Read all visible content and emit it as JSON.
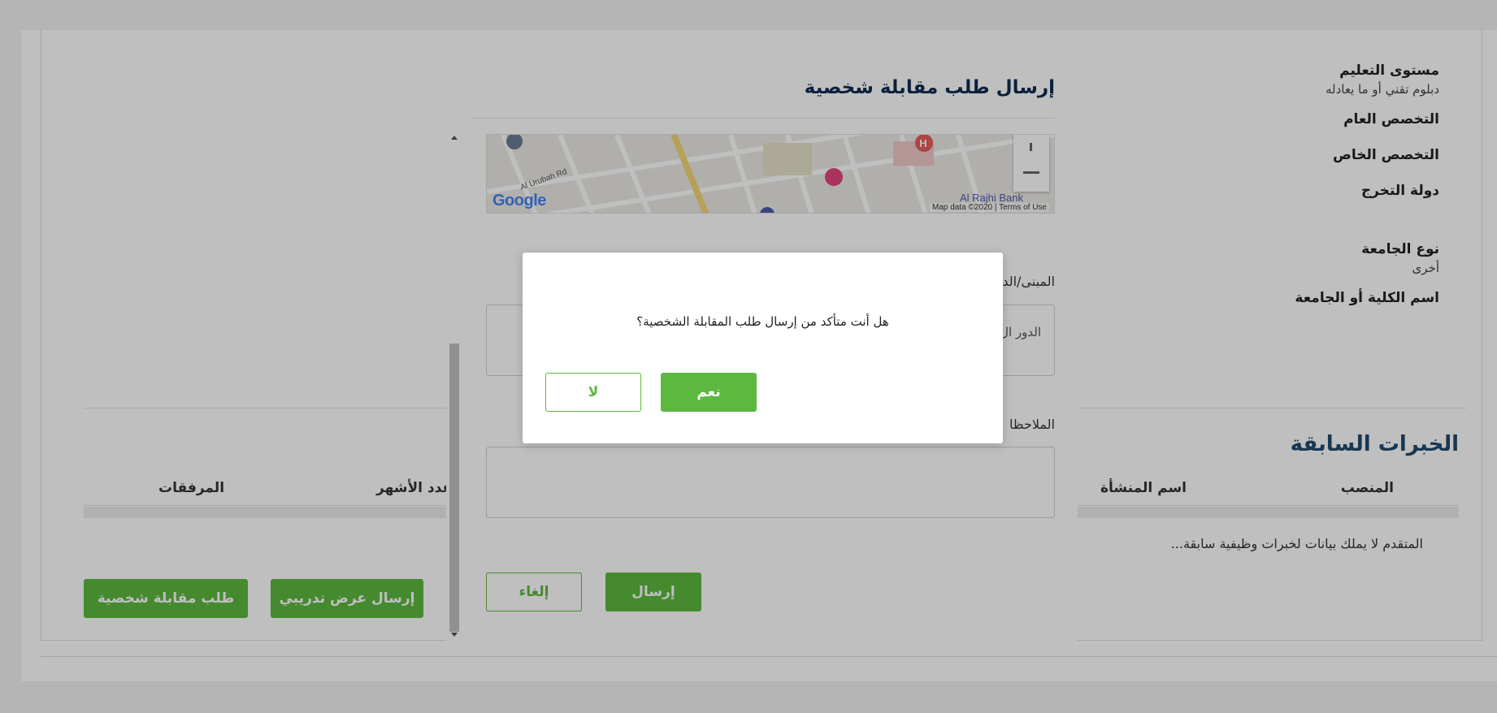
{
  "education": {
    "level_label": "مستوى التعليم",
    "level_value": "دبلوم تقني أو ما يعادله",
    "general_major_label": "التخصص العام",
    "special_major_label": "التخصص الخاص",
    "grad_country_label": "دولة التخرج",
    "university_type_label": "نوع الجامعة",
    "university_type_value": "أخرى",
    "college_name_label": "اسم الكلية أو الجامعة"
  },
  "experience": {
    "title": "الخبرات السابقة",
    "columns": [
      "المنصب",
      "اسم المنشأة",
      "عدد الأشهر",
      "المرفقات"
    ],
    "empty_text": "المتقدم لا يملك بيانات لخبرات وظيفية سابقة..."
  },
  "page_buttons": {
    "interview": "طلب مقابلة شخصية",
    "training": "إرسال عرض تدريبي"
  },
  "modal": {
    "title": "إرسال طلب مقابلة شخصية",
    "map": {
      "logo": "Google",
      "copyright": "Map data ©2020",
      "terms": "Terms of Use",
      "label_bank": "Al Rajhi Bank",
      "label_road": "Al Urubah Rd"
    },
    "building_label": "المبنى/الد",
    "floor_text": "الدور ال",
    "notes_label": "الملاحظا",
    "send": "إرسال",
    "cancel": "إلغاء"
  },
  "confirm": {
    "question": "هل أنت متأكد من إرسال طلب المقابلة الشخصية؟",
    "yes": "نعم",
    "no": "لا"
  },
  "colors": {
    "accent": "#5cb83f",
    "title": "#0f2b52",
    "section_title": "#1f4a6e"
  }
}
